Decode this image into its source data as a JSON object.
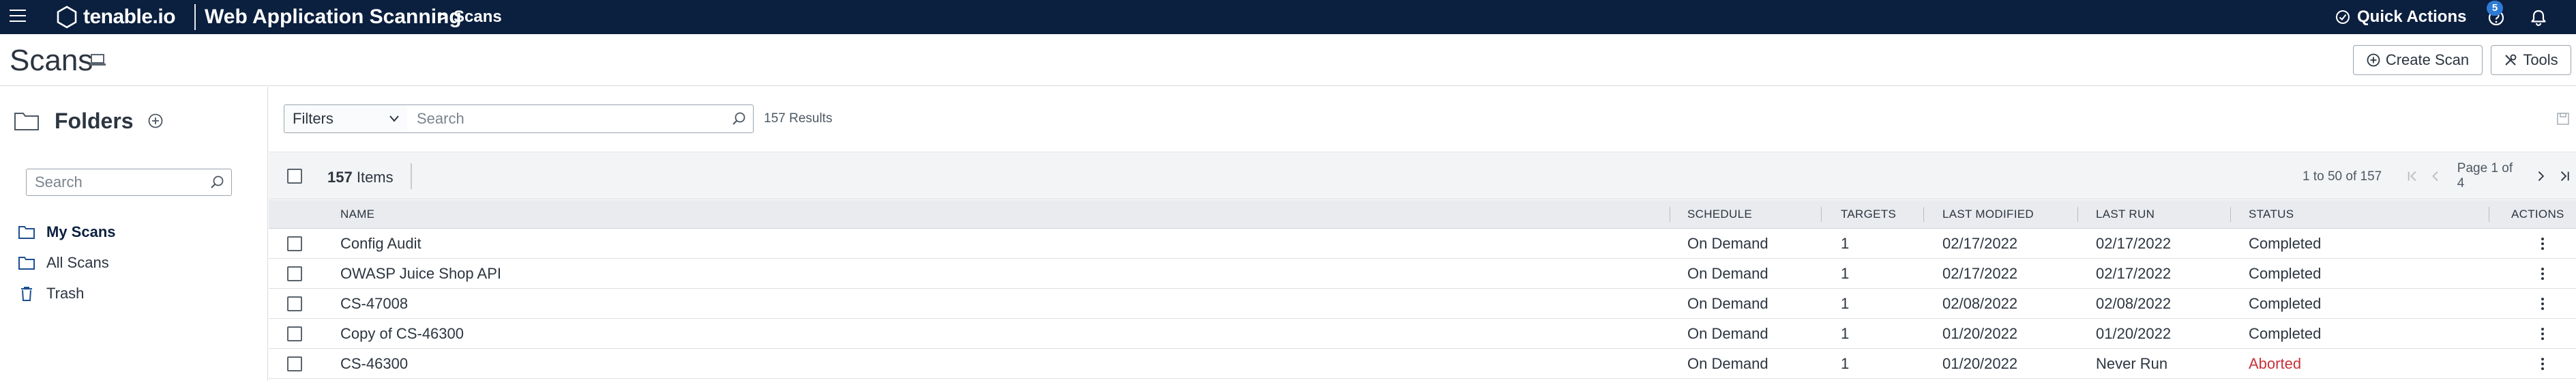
{
  "topbar": {
    "logo_text": "tenable.io",
    "product": "Web Application Scanning",
    "breadcrumb_arrow": ">",
    "breadcrumb": "Scans",
    "quick_actions": "Quick Actions",
    "notification_count": "5",
    "bg_color": "#0b1f3f"
  },
  "header": {
    "title": "Scans",
    "create_scan": "Create Scan",
    "tools": "Tools"
  },
  "sidebar": {
    "title": "Folders",
    "search_placeholder": "Search",
    "items": [
      {
        "label": "My Scans",
        "icon": "folder-icon",
        "active": true
      },
      {
        "label": "All Scans",
        "icon": "folder-icon",
        "active": false
      },
      {
        "label": "Trash",
        "icon": "trash-icon",
        "active": false
      }
    ]
  },
  "filters": {
    "label": "Filters",
    "search_placeholder": "Search",
    "results": "157 Results"
  },
  "items_bar": {
    "count": "157",
    "count_suffix": "Items",
    "range": "1 to 50 of 157",
    "page_label": "Page 1 of 4"
  },
  "table": {
    "columns": {
      "name": "NAME",
      "schedule": "SCHEDULE",
      "targets": "TARGETS",
      "last_modified": "LAST MODIFIED",
      "last_run": "LAST RUN",
      "status": "STATUS",
      "actions": "ACTIONS"
    },
    "rows": [
      {
        "name": "Config Audit",
        "schedule": "On Demand",
        "targets": "1",
        "last_modified": "02/17/2022",
        "last_run": "02/17/2022",
        "status": "Completed"
      },
      {
        "name": "OWASP Juice Shop API",
        "schedule": "On Demand",
        "targets": "1",
        "last_modified": "02/17/2022",
        "last_run": "02/17/2022",
        "status": "Completed"
      },
      {
        "name": "CS-47008",
        "schedule": "On Demand",
        "targets": "1",
        "last_modified": "02/08/2022",
        "last_run": "02/08/2022",
        "status": "Completed"
      },
      {
        "name": "Copy of CS-46300",
        "schedule": "On Demand",
        "targets": "1",
        "last_modified": "01/20/2022",
        "last_run": "01/20/2022",
        "status": "Completed"
      },
      {
        "name": "CS-46300",
        "schedule": "On Demand",
        "targets": "1",
        "last_modified": "01/20/2022",
        "last_run": "Never Run",
        "status": "Aborted"
      }
    ],
    "aborted_color": "#c8313a"
  }
}
